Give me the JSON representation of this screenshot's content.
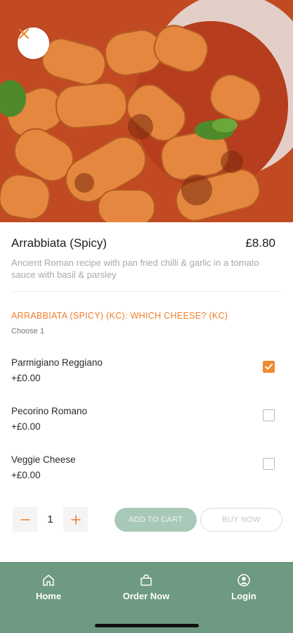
{
  "item": {
    "title": "Arrabbiata (Spicy)",
    "price": "£8.80",
    "description": "Ancient Roman recipe with pan fried chilli & garlic in a tomato sauce with basil & parsley"
  },
  "option_group": {
    "title": "ARRABBIATA (SPICY) (KC): WHICH CHEESE? (KC)",
    "subtitle": "Choose 1",
    "options": [
      {
        "name": "Parmigiano Reggiano",
        "price": "+£0.00",
        "selected": true
      },
      {
        "name": "Pecorino Romano",
        "price": "+£0.00",
        "selected": false
      },
      {
        "name": "Veggie Cheese",
        "price": "+£0.00",
        "selected": false
      }
    ]
  },
  "quantity": {
    "value": "1"
  },
  "actions": {
    "add_to_cart": "ADD TO CART",
    "buy_now": "BUY NOW"
  },
  "nav": {
    "items": [
      {
        "label": "Home",
        "icon": "home-icon"
      },
      {
        "label": "Order Now",
        "icon": "bag-icon"
      },
      {
        "label": "Login",
        "icon": "user-circle-icon"
      }
    ]
  },
  "colors": {
    "accent": "#ef7d2b",
    "nav_bg": "#6d9a80",
    "add_to_cart_bg": "#a9c9b8"
  }
}
